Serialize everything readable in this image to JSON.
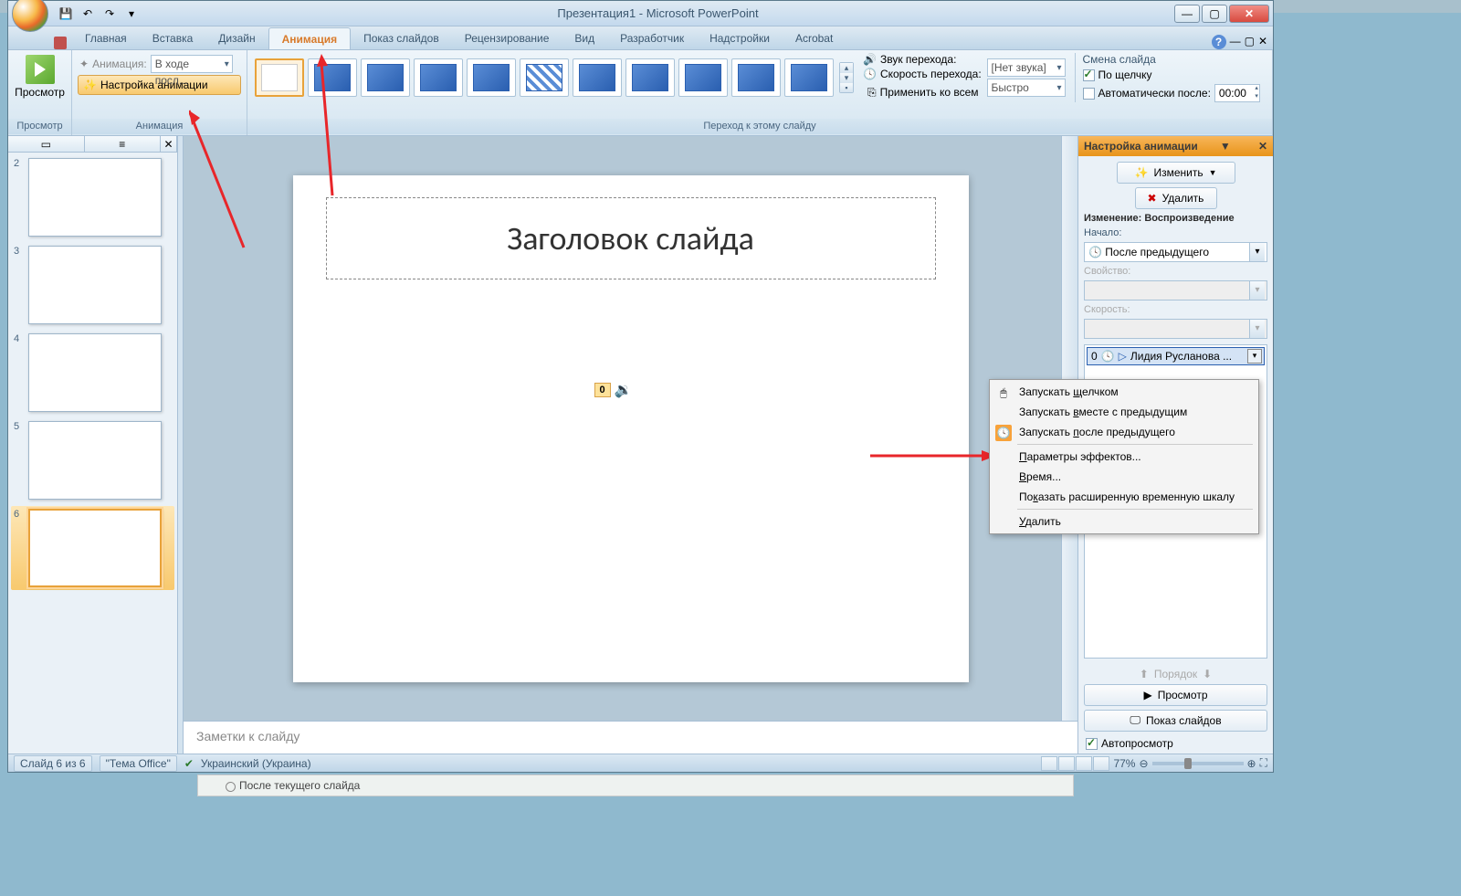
{
  "title": "Презентация1 - Microsoft PowerPoint",
  "tabs": [
    "Главная",
    "Вставка",
    "Дизайн",
    "Анимация",
    "Показ слайдов",
    "Рецензирование",
    "Вид",
    "Разработчик",
    "Надстройки",
    "Acrobat"
  ],
  "active_tab": "Анимация",
  "ribbon": {
    "preview_group": {
      "button": "Просмотр",
      "label": "Просмотр"
    },
    "anim_group": {
      "anim_label": "Анимация:",
      "anim_value": "В ходе посл...",
      "custom_btn": "Настройка анимации",
      "label": "Анимация"
    },
    "transition_group_label": "Переход к этому слайду",
    "sound_label": "Звук перехода:",
    "sound_value": "[Нет звука]",
    "speed_label": "Скорость перехода:",
    "speed_value": "Быстро",
    "apply_all": "Применить ко всем",
    "advance_title": "Смена слайда",
    "on_click": "По щелчку",
    "auto_after": "Автоматически после:",
    "auto_time": "00:00"
  },
  "doc_tab": "Презентация1",
  "thumbs": [
    {
      "n": "2"
    },
    {
      "n": "3"
    },
    {
      "n": "4"
    },
    {
      "n": "5"
    },
    {
      "n": "6",
      "active": true
    }
  ],
  "slide": {
    "title": "Заголовок слайда",
    "sound_badge": "0"
  },
  "notes_placeholder": "Заметки к слайду",
  "taskpane": {
    "title": "Настройка анимации",
    "modify_btn": "Изменить",
    "remove_btn": "Удалить",
    "change_header": "Изменение: Воспроизведение",
    "start_label": "Начало:",
    "start_value": "После предыдущего",
    "prop_label": "Свойство:",
    "speed_label": "Скорость:",
    "item_order": "0",
    "item_name": "Лидия Русланова ...",
    "reorder": "Порядок",
    "play_btn": "Просмотр",
    "slideshow_btn": "Показ слайдов",
    "autopreview": "Автопросмотр"
  },
  "context_menu": {
    "items": [
      {
        "text": "Запускать щелчком",
        "u": "щ",
        "icon": "mouse"
      },
      {
        "text": "Запускать вместе с предыдущим",
        "u": "в"
      },
      {
        "text": "Запускать после предыдущего",
        "u": "п",
        "icon": "clock"
      },
      {
        "sep": true
      },
      {
        "text": "Параметры эффектов...",
        "u": "П"
      },
      {
        "text": "Время...",
        "u": "В"
      },
      {
        "text": "Показать расширенную временную шкалу",
        "u": "к"
      },
      {
        "sep": true
      },
      {
        "text": "Удалить",
        "u": "У"
      }
    ]
  },
  "statusbar": {
    "slide": "Слайд 6 из 6",
    "theme": "\"Тема Office\"",
    "lang": "Украинский (Украина)",
    "zoom": "77%"
  },
  "beyond_radio": "После текущего слайда"
}
